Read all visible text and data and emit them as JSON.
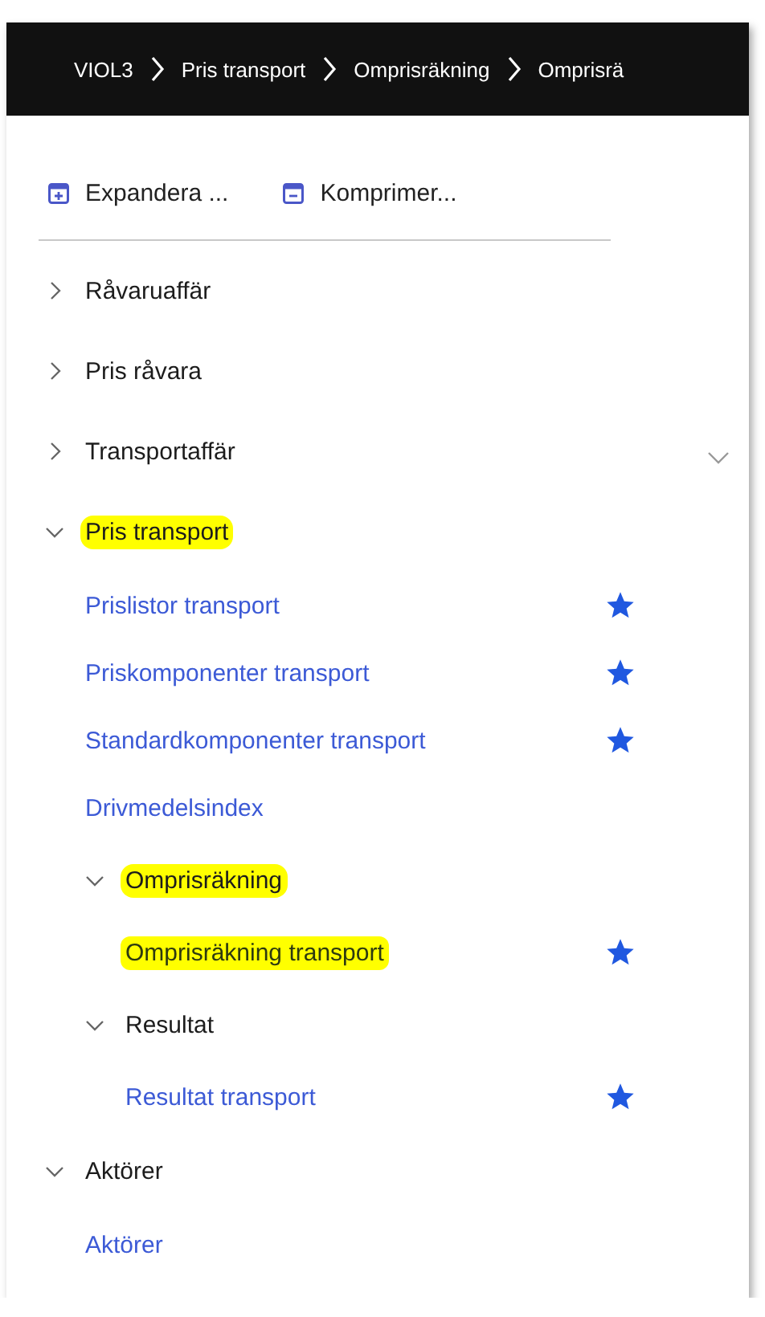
{
  "breadcrumb": [
    "VIOL3",
    "Pris transport",
    "Omprisräkning",
    "Omprisrä"
  ],
  "toolbar": [
    {
      "kind": "expand",
      "label": "Expandera ..."
    },
    {
      "kind": "collapse",
      "label": "Komprimer..."
    }
  ],
  "tree": [
    {
      "kind": "group",
      "label": "Råvaruaffär",
      "expanded": false,
      "highlighted": false
    },
    {
      "kind": "group",
      "label": "Pris råvara",
      "expanded": false,
      "highlighted": false
    },
    {
      "kind": "group",
      "label": "Transportaffär",
      "expanded": false,
      "highlighted": false
    },
    {
      "kind": "group",
      "label": "Pris transport",
      "expanded": true,
      "highlighted": true,
      "children": [
        {
          "kind": "link",
          "label": "Prislistor transport",
          "favorite": true,
          "highlighted": false
        },
        {
          "kind": "link",
          "label": "Priskomponenter transport",
          "favorite": true,
          "highlighted": false
        },
        {
          "kind": "link",
          "label": "Standardkomponenter transport",
          "favorite": true,
          "highlighted": false
        },
        {
          "kind": "link",
          "label": "Drivmedelsindex",
          "favorite": false,
          "highlighted": false
        },
        {
          "kind": "group",
          "label": "Omprisräkning",
          "expanded": true,
          "highlighted": true,
          "children": [
            {
              "kind": "link",
              "label": "Omprisräkning transport",
              "favorite": true,
              "highlighted": true
            }
          ]
        },
        {
          "kind": "group",
          "label": "Resultat",
          "expanded": true,
          "highlighted": false,
          "children": [
            {
              "kind": "link",
              "label": "Resultat transport",
              "favorite": true,
              "highlighted": false
            }
          ]
        }
      ]
    },
    {
      "kind": "group",
      "label": "Aktörer",
      "expanded": true,
      "highlighted": false,
      "children": [
        {
          "kind": "link",
          "label": "Aktörer",
          "favorite": false,
          "highlighted": false
        }
      ]
    }
  ]
}
